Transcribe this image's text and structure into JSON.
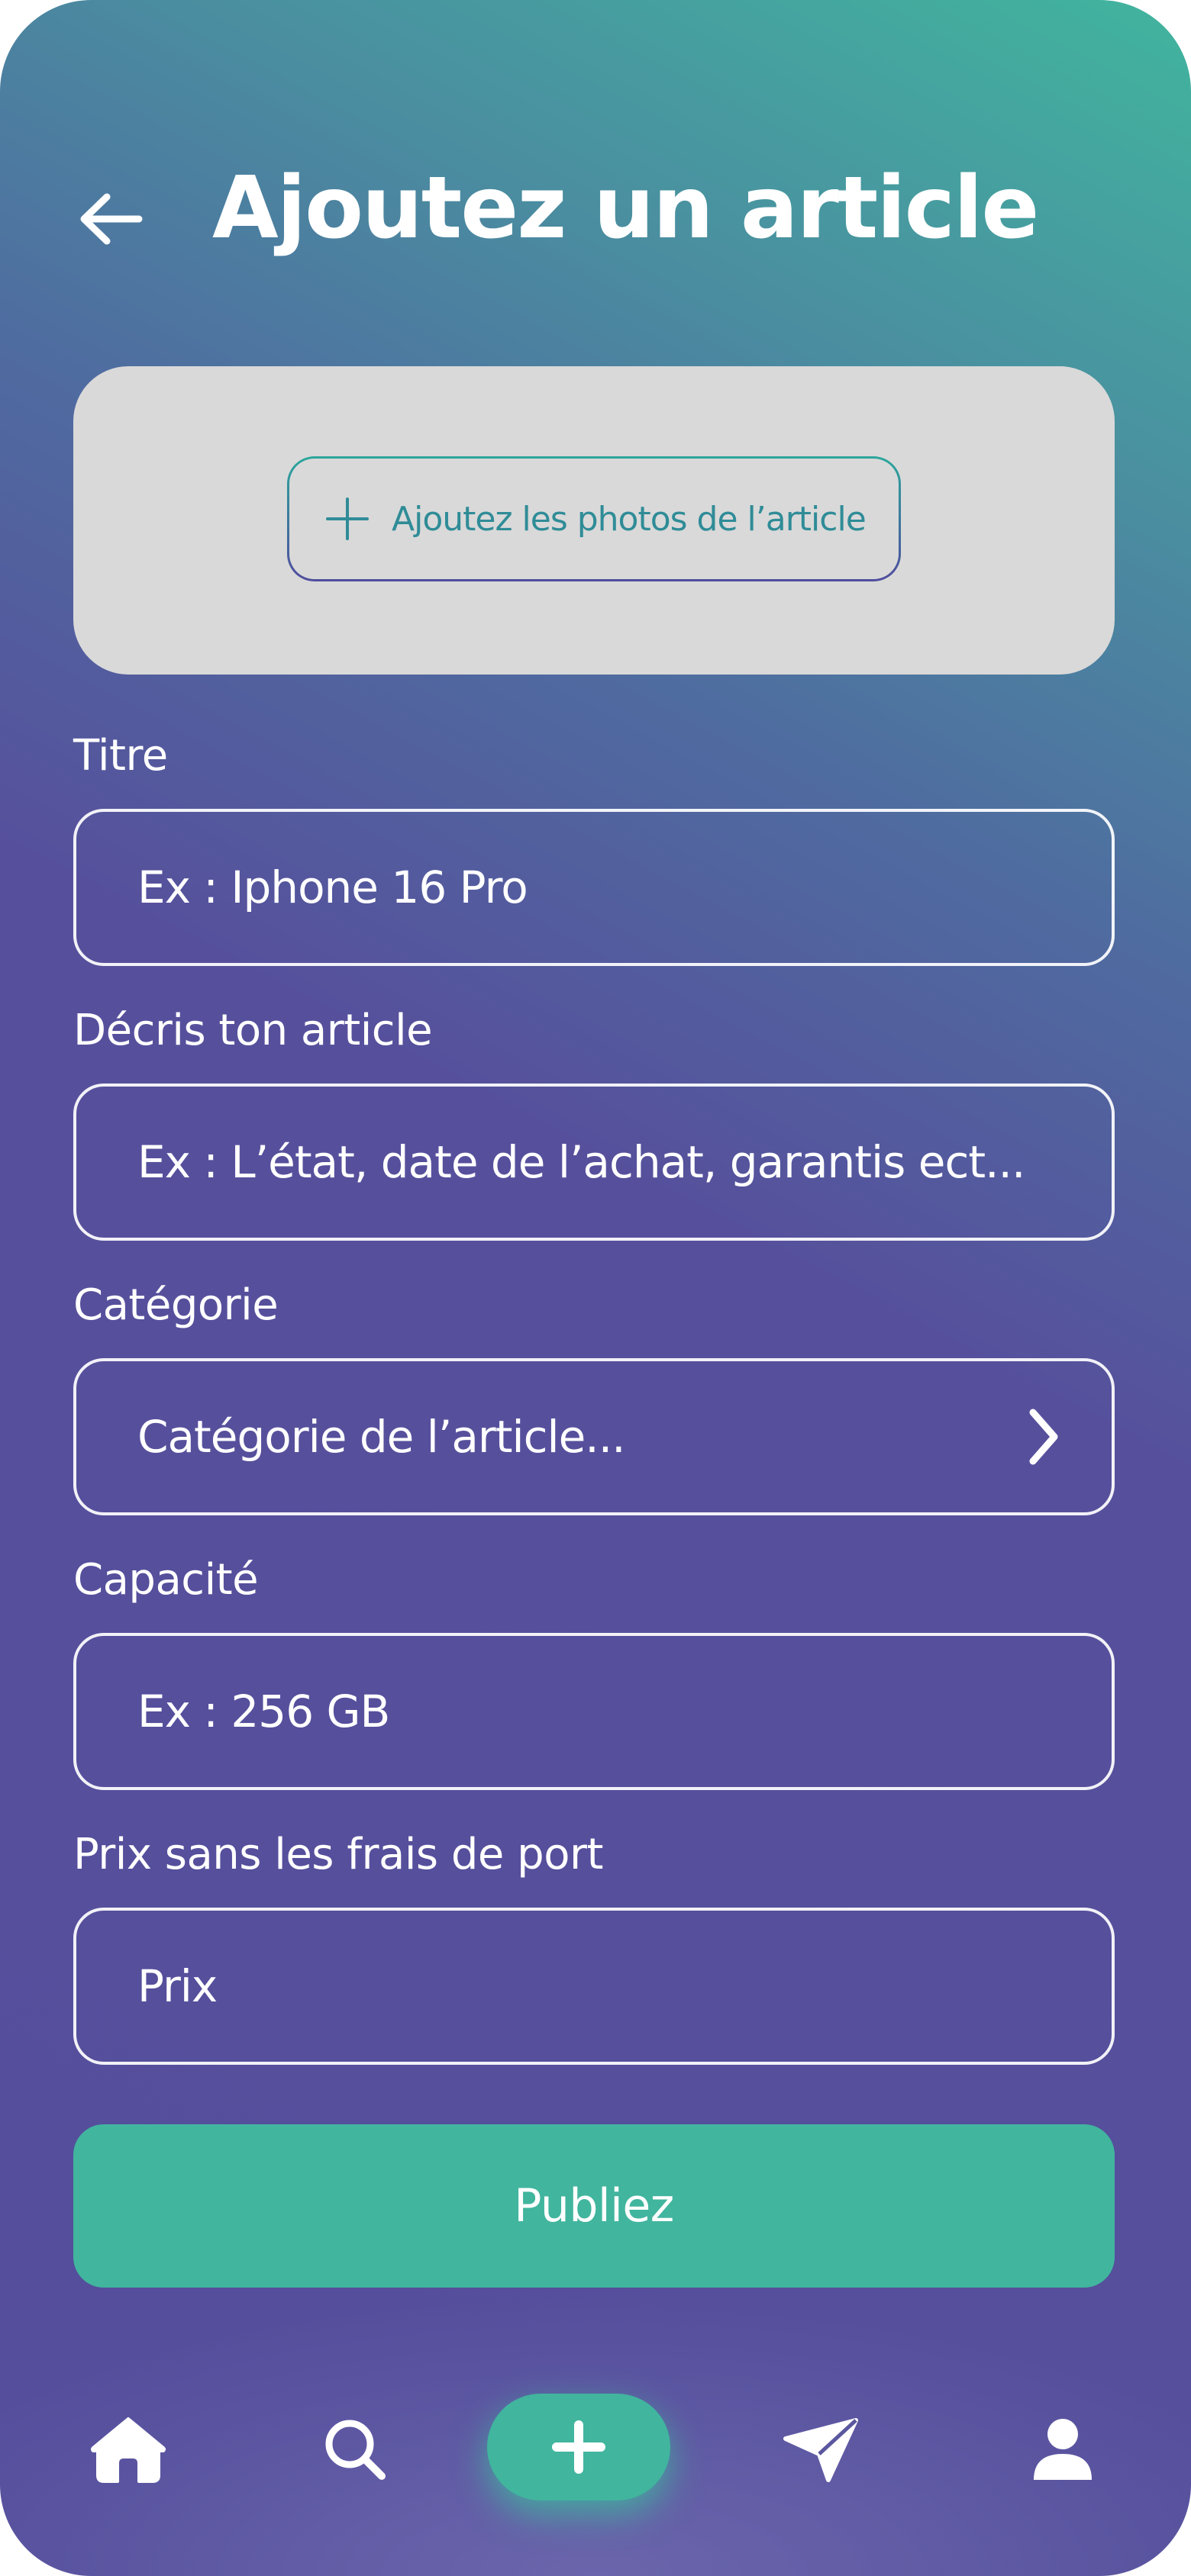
{
  "header": {
    "title": "Ajoutez un article",
    "back_icon": "arrow-left-icon"
  },
  "photo_upload": {
    "button_label": "Ajoutez les photos de l’article",
    "icon": "plus-icon"
  },
  "form": {
    "title": {
      "label": "Titre",
      "placeholder": "Ex : Iphone 16 Pro"
    },
    "description": {
      "label": "Décris ton article",
      "placeholder": "Ex : L’état, date de l’achat, garantis ect..."
    },
    "category": {
      "label": "Catégorie",
      "placeholder": "Catégorie de l’article...",
      "icon": "chevron-right-icon"
    },
    "capacity": {
      "label": "Capacité",
      "placeholder": "Ex : 256 GB"
    },
    "price": {
      "label": "Prix sans les frais de port",
      "placeholder": "Prix"
    }
  },
  "publish_button": {
    "label": "Publiez"
  },
  "bottom_nav": {
    "items": [
      {
        "icon": "home-icon"
      },
      {
        "icon": "search-icon"
      },
      {
        "icon": "plus-icon"
      },
      {
        "icon": "send-icon"
      },
      {
        "icon": "user-icon"
      }
    ]
  },
  "colors": {
    "accent": "#41B59E",
    "background_purple": "#544E9C",
    "panel_gray": "#D9D9D9",
    "upload_text": "#2F8C97"
  }
}
